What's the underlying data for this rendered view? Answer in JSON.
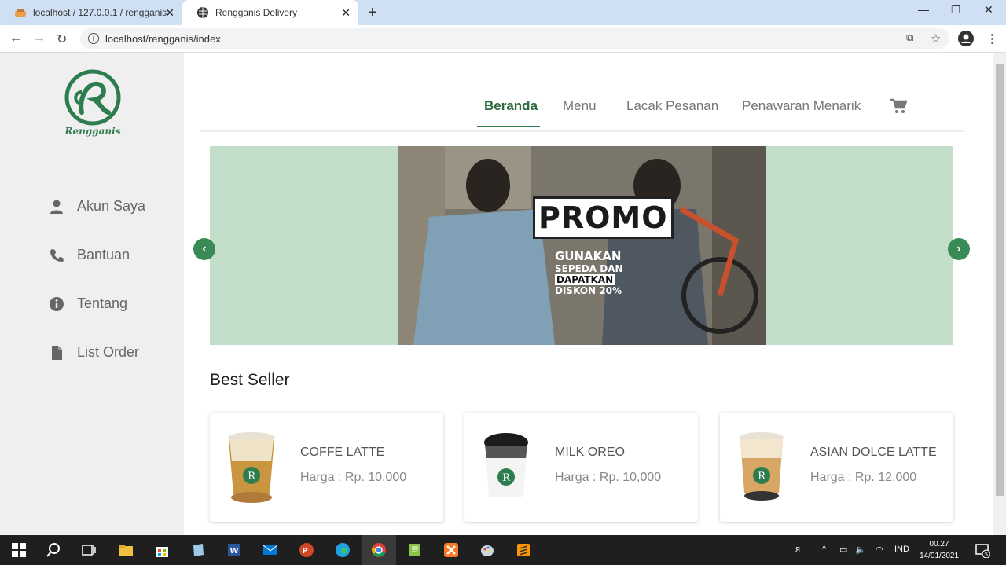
{
  "browser": {
    "tabs": [
      {
        "title": "localhost / 127.0.0.1 / rengganis",
        "active": false
      },
      {
        "title": "Rengganis Delivery",
        "active": true
      }
    ],
    "url": "localhost/rengganis/index"
  },
  "brand": {
    "logo_text": "Rengganis",
    "color": "#2e7d4f"
  },
  "sidebar": {
    "items": [
      {
        "label": "Akun Saya",
        "icon": "user-icon"
      },
      {
        "label": "Bantuan",
        "icon": "phone-icon"
      },
      {
        "label": "Tentang",
        "icon": "info-icon"
      },
      {
        "label": "List Order",
        "icon": "file-icon"
      }
    ]
  },
  "nav": {
    "items": [
      {
        "label": "Beranda",
        "active": true
      },
      {
        "label": "Menu",
        "active": false
      },
      {
        "label": "Lacak Pesanan",
        "active": false
      },
      {
        "label": "Penawaran Menarik",
        "active": false
      }
    ],
    "cart_icon": "cart-icon"
  },
  "banner": {
    "title": "PROMO",
    "line1": "GUNAKAN",
    "line2": "SEPEDA DAN",
    "line3": "DAPATKAN",
    "line4": "DISKON 20%"
  },
  "best_seller": {
    "title": "Best Seller",
    "products": [
      {
        "name": "COFFE LATTE",
        "price": "Harga : Rp. 10,000"
      },
      {
        "name": "MILK OREO",
        "price": "Harga : Rp. 10,000"
      },
      {
        "name": "ASIAN DOLCE LATTE",
        "price": "Harga : Rp. 12,000"
      }
    ]
  },
  "taskbar": {
    "lang": "IND",
    "time": "00.27",
    "date": "14/01/2021",
    "notifications": "5"
  }
}
